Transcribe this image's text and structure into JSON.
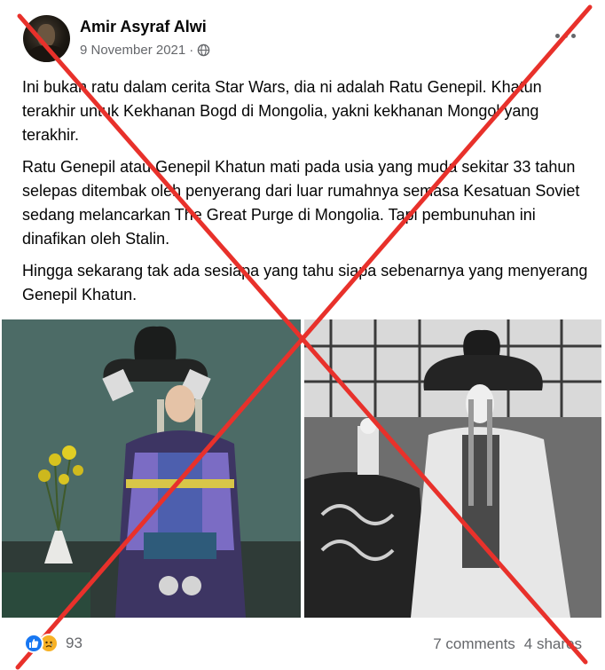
{
  "post": {
    "author": "Amir Asyraf Alwi",
    "date": "9 November 2021",
    "separator": "·",
    "privacy_icon": "globe-icon",
    "more_icon": "more-options-icon",
    "paragraphs": [
      "Ini bukan ratu dalam cerita Star Wars, dia ni adalah Ratu Genepil. Khatun terakhir untuk Kekhanan Bogd di Mongolia, yakni kekhanan Mongol yang terakhir.",
      "Ratu Genepil atau Genepil Khatun mati pada usia yang muda sekitar 33 tahun selepas ditembak oleh penyerang dari luar rumahnya semasa Kesatuan Soviet sedang melancarkan The Great Purge di Mongolia. Tapi pembunuhan ini dinafikan oleh Stalin.",
      "Hingga sekarang tak ada sesiapa yang tahu siapa sebenarnya yang menyerang Genepil Khatun."
    ],
    "photos": [
      {
        "name": "colorized-portrait"
      },
      {
        "name": "black-and-white-portrait"
      }
    ]
  },
  "footer": {
    "reaction_icons": [
      "like-icon",
      "sad-icon"
    ],
    "reaction_count": "93",
    "comments": "7 comments",
    "shares": "4 shares"
  },
  "overlay": {
    "cross_color": "#e8312b"
  }
}
